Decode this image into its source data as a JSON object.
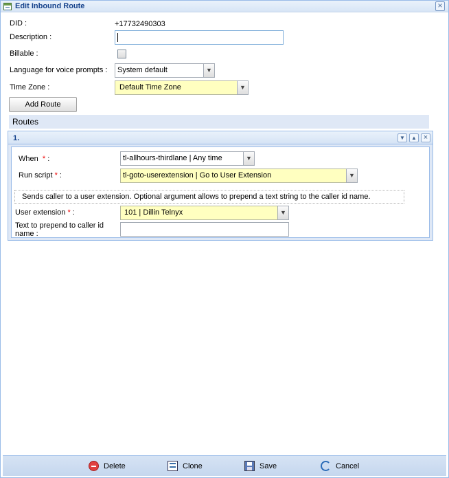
{
  "window": {
    "title": "Edit Inbound Route",
    "close_icon": "close-icon"
  },
  "form": {
    "did_label": "DID :",
    "did_value": "+17732490303",
    "description_label": "Description :",
    "description_value": "",
    "billable_label": "Billable :",
    "billable_checked": false,
    "language_label": "Language for voice prompts :",
    "language_value": "System default",
    "timezone_label": "Time Zone :",
    "timezone_value": "Default Time Zone",
    "add_route_label": "Add Route"
  },
  "routes": {
    "header": "Routes",
    "items": [
      {
        "number": "1.",
        "when_label": "When",
        "when_value": "tl-allhours-thirdlane | Any time",
        "run_script_label": "Run script",
        "run_script_value": "tl-goto-userextension | Go to User Extension",
        "script_description": "Sends caller to a user extension. Optional argument allows to prepend a text string to the caller id name.",
        "user_extension_label": "User extension",
        "user_extension_value": "101 | Dillin Telnyx",
        "prepend_label_line1": "Text to prepend to caller id",
        "prepend_label_line2": "name :",
        "prepend_value": ""
      }
    ]
  },
  "footer": {
    "delete_label": "Delete",
    "clone_label": "Clone",
    "save_label": "Save",
    "cancel_label": "Cancel"
  },
  "colors": {
    "accent": "#15428b",
    "panel_bg": "#dfe8f6",
    "required": "#e00000",
    "combo_highlight": "#ffffc0"
  }
}
